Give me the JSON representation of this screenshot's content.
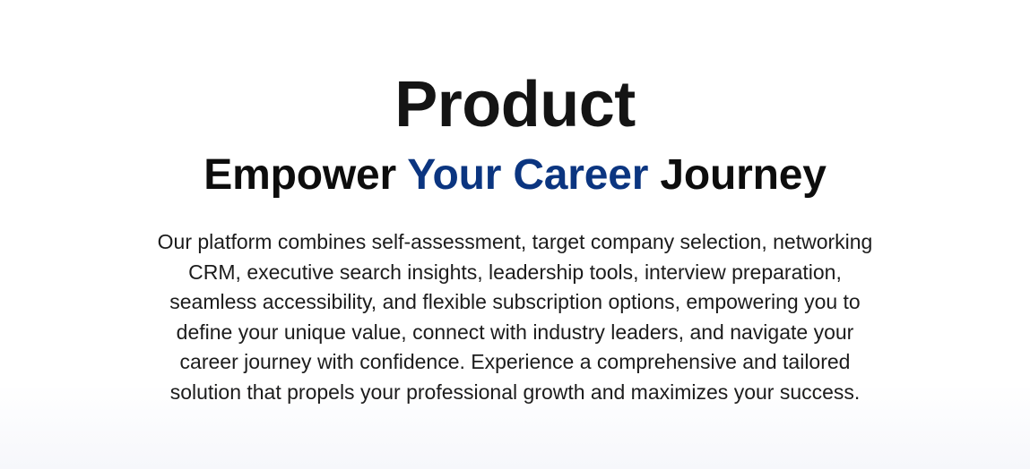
{
  "product_section": {
    "title": "Product",
    "subtitle": {
      "part1": "Empower ",
      "highlight": "Your Career",
      "part2": " Journey",
      "accent_color": "#0b3580"
    },
    "description_lines": [
      "Our platform combines self-assessment, target company selection, networking",
      "CRM, executive search insights, leadership tools, interview preparation,",
      "seamless accessibility, and flexible subscription options, empowering you to",
      "define your unique value, connect with industry leaders, and navigate your",
      "career journey with confidence. Experience a comprehensive and tailored",
      "solution that propels your professional growth and maximizes your success."
    ]
  }
}
